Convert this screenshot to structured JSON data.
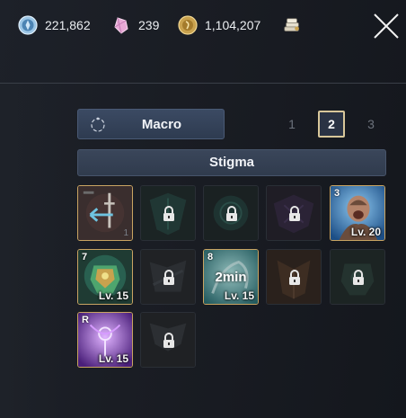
{
  "currencies": [
    {
      "name": "blue-gem",
      "value": "221,862",
      "color": "#7fb4d8"
    },
    {
      "name": "pink-crystal",
      "value": "239",
      "color": "#e7a6d2"
    },
    {
      "name": "gold-coin",
      "value": "1,104,207",
      "color": "#d1ad5a"
    }
  ],
  "macro": {
    "label": "Macro"
  },
  "pages": [
    "1",
    "2",
    "3"
  ],
  "active_page": "2",
  "section": {
    "label": "Stigma"
  },
  "slots": [
    {
      "state": "equipped",
      "art": "sword-arrow",
      "corner": "1"
    },
    {
      "state": "locked",
      "art": "teal"
    },
    {
      "state": "locked",
      "art": "teal-dark"
    },
    {
      "state": "locked",
      "art": "gray"
    },
    {
      "state": "locked",
      "art": "purple"
    },
    {
      "state": "equipped",
      "art": "warrior",
      "num": "3",
      "level": "Lv. 20"
    },
    {
      "state": "equipped",
      "art": "green-armor",
      "num": "7",
      "level": "Lv. 15"
    },
    {
      "state": "locked",
      "art": "gray"
    },
    {
      "state": "equipped",
      "art": "teal-swirl",
      "num": "8",
      "level": "Lv. 15",
      "cooldown": "2min"
    },
    {
      "state": "locked",
      "art": "brown"
    },
    {
      "state": "locked",
      "art": "teal-dark"
    },
    {
      "state": "equipped",
      "art": "purple-orb",
      "num": "R",
      "level": "Lv. 15"
    },
    {
      "state": "locked",
      "art": "gray"
    }
  ]
}
